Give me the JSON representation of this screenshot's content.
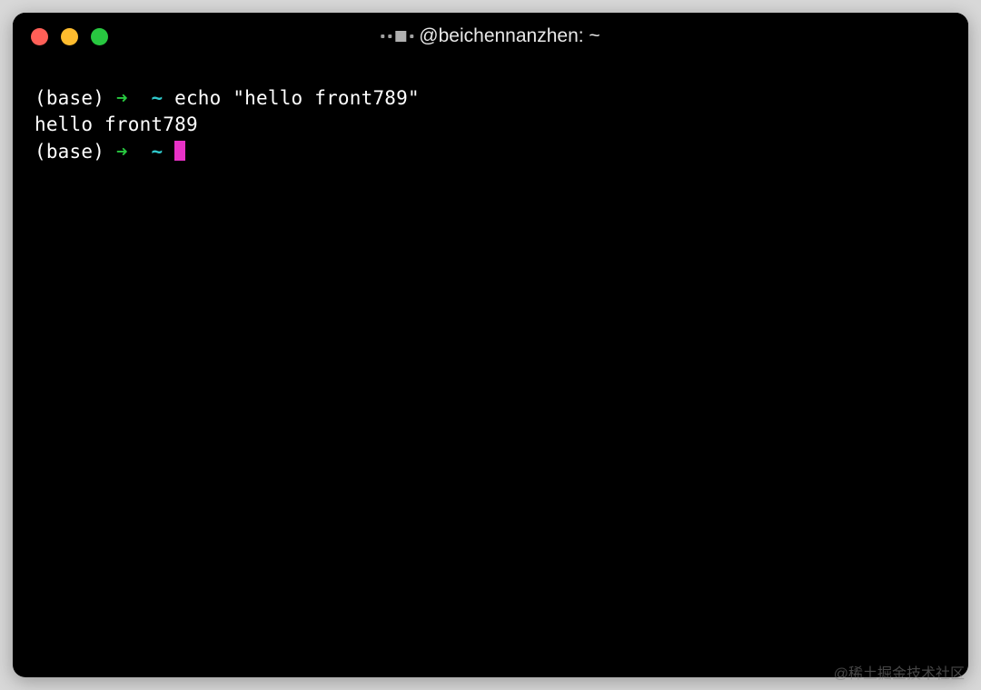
{
  "window": {
    "title_visible": "@beichennanzhen: ~"
  },
  "prompt": {
    "env": "(base)",
    "arrow": "➜",
    "path": "~"
  },
  "lines": [
    {
      "command": "echo \"hello front789\""
    },
    {
      "output": "hello front789"
    }
  ],
  "watermark": "@稀土掘金技术社区"
}
